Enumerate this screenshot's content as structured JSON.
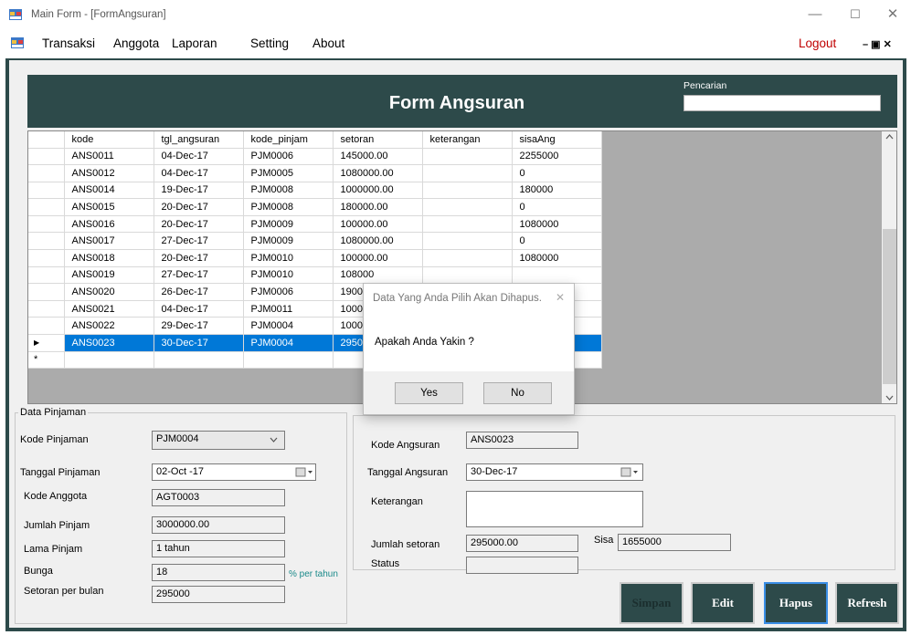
{
  "window": {
    "title": "Main Form - [FormAngsuran]",
    "minimize": "—",
    "maximize": "☐",
    "close": "✕"
  },
  "menu": {
    "items": [
      "Transaksi",
      "Anggota",
      "Laporan",
      "Setting",
      "About"
    ],
    "logout": "Logout",
    "mdi_controls": "– ▣ ✕"
  },
  "header": {
    "title": "Form Angsuran",
    "search_label": "Pencarian",
    "search_value": ""
  },
  "grid": {
    "columns": [
      "kode",
      "tgl_angsuran",
      "kode_pinjam",
      "setoran",
      "keterangan",
      "sisaAng"
    ],
    "rows": [
      [
        "ANS0011",
        "04-Dec-17",
        "PJM0006",
        "145000.00",
        "",
        "2255000"
      ],
      [
        "ANS0012",
        "04-Dec-17",
        "PJM0005",
        "1080000.00",
        "",
        "0"
      ],
      [
        "ANS0014",
        "19-Dec-17",
        "PJM0008",
        "1000000.00",
        "",
        "180000"
      ],
      [
        "ANS0015",
        "20-Dec-17",
        "PJM0008",
        "180000.00",
        "",
        "0"
      ],
      [
        "ANS0016",
        "20-Dec-17",
        "PJM0009",
        "100000.00",
        "",
        "1080000"
      ],
      [
        "ANS0017",
        "27-Dec-17",
        "PJM0009",
        "1080000.00",
        "",
        "0"
      ],
      [
        "ANS0018",
        "20-Dec-17",
        "PJM0010",
        "100000.00",
        "",
        "1080000"
      ],
      [
        "ANS0019",
        "27-Dec-17",
        "PJM0010",
        "108000",
        "",
        ""
      ],
      [
        "ANS0020",
        "26-Dec-17",
        "PJM0006",
        "190000",
        "",
        ""
      ],
      [
        "ANS0021",
        "04-Dec-17",
        "PJM0011",
        "100000",
        "",
        ""
      ],
      [
        "ANS0022",
        "29-Dec-17",
        "PJM0004",
        "100000",
        "",
        ""
      ],
      [
        "ANS0023",
        "30-Dec-17",
        "PJM0004",
        "29500",
        "",
        ""
      ]
    ],
    "selected_row_marker": "▶",
    "new_row_marker": "*"
  },
  "pinjaman": {
    "group_label": "Data Pinjaman",
    "kode_label": "Kode Pinjaman",
    "kode_value": "PJM0004",
    "tanggal_label": "Tanggal Pinjaman",
    "tanggal_value": "02-Oct -17",
    "anggota_label": "Kode Anggota",
    "anggota_value": "AGT0003",
    "jumlah_label": "Jumlah Pinjam",
    "jumlah_value": "3000000.00",
    "lama_label": "Lama Pinjam",
    "lama_value": "1 tahun",
    "bunga_label": "Bunga",
    "bunga_value": "18",
    "bunga_unit": "% per tahun",
    "setoran_label": "Setoran per bulan",
    "setoran_value": "295000"
  },
  "angsuran": {
    "kode_label": "Kode Angsuran",
    "kode_value": "ANS0023",
    "tanggal_label": "Tanggal Angsuran",
    "tanggal_value": "30-Dec-17",
    "keterangan_label": "Keterangan",
    "keterangan_value": "",
    "jumlah_label": "Jumlah setoran",
    "jumlah_value": "295000.00",
    "sisa_label": "Sisa",
    "sisa_value": "1655000",
    "status_label": "Status",
    "status_value": ""
  },
  "buttons": {
    "simpan": "Simpan",
    "edit": "Edit",
    "hapus": "Hapus",
    "refresh": "Refresh"
  },
  "dialog": {
    "title": "Data Yang Anda Pilih Akan Dihapus.",
    "close": "✕",
    "message": "Apakah Anda Yakin ?",
    "yes": "Yes",
    "no": "No"
  },
  "colors": {
    "accent": "#2d4a4a",
    "selection": "#0078d7"
  }
}
